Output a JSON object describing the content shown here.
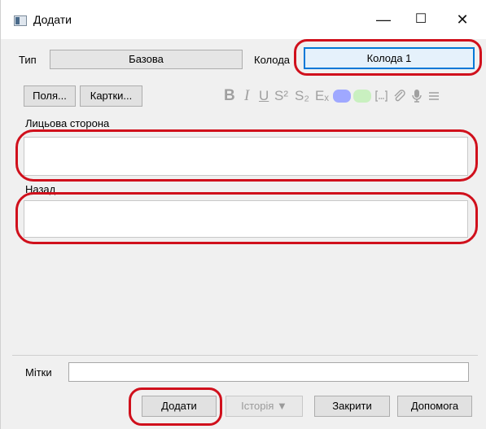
{
  "window": {
    "title": "Додати"
  },
  "titlebar_buttons": {
    "minimize": "—",
    "maximize": "☐",
    "close": "✕"
  },
  "note_type": {
    "label": "Тип",
    "value": "Базова"
  },
  "deck": {
    "label": "Колода",
    "value": "Колода 1"
  },
  "buttons": {
    "fields": "Поля...",
    "cards": "Картки..."
  },
  "toolbar": {
    "bold": "B",
    "italic": "I",
    "underline": "U",
    "superscript": "S²",
    "subscript": "S₂",
    "clear_format": "Eₓ",
    "color_text": "#9fa8ff",
    "color_highlight": "#c9f0c0"
  },
  "fields": [
    {
      "label": "Лицьова сторона",
      "value": ""
    },
    {
      "label": "Назад",
      "value": ""
    }
  ],
  "tags": {
    "label": "Мітки",
    "value": ""
  },
  "bottom_buttons": {
    "add": "Додати",
    "history": "Історія ▼",
    "close": "Закрити",
    "help": "Допомога"
  },
  "annotation_color": "#d0101c"
}
